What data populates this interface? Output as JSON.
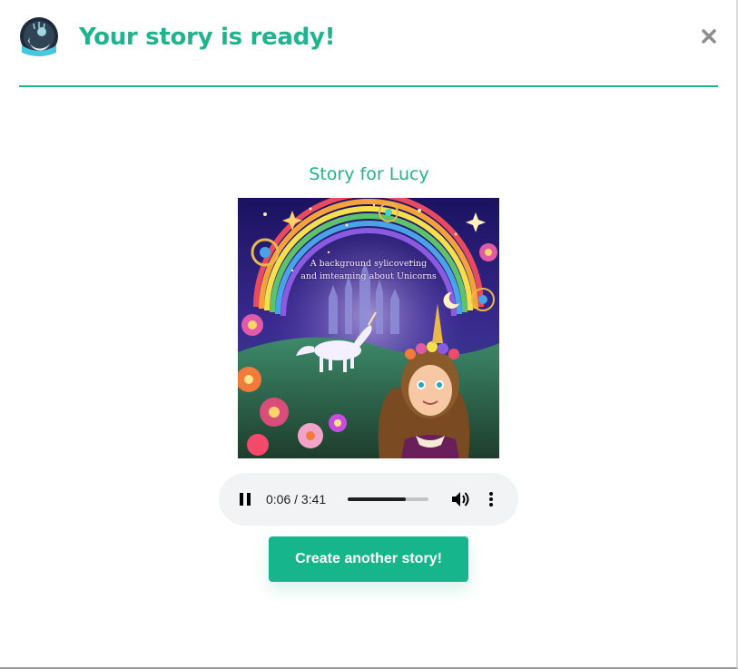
{
  "header": {
    "title": "Your story is ready!",
    "logo_icon": "moon-night-logo-icon",
    "close_icon": "close-icon"
  },
  "story": {
    "title": "Story for Lucy",
    "cover_text_line1": "A background sylicovering",
    "cover_text_line2": "and imteaming about Unicorns"
  },
  "audio_player": {
    "state": "playing",
    "current_time": "0:06",
    "duration": "3:41",
    "time_display": "0:06 / 3:41",
    "progress": 0.72
  },
  "cta": {
    "label": "Create another story!"
  },
  "colors": {
    "accent": "#1fb38e",
    "button": "#16b58c",
    "player_bg": "#f1f3f4"
  }
}
